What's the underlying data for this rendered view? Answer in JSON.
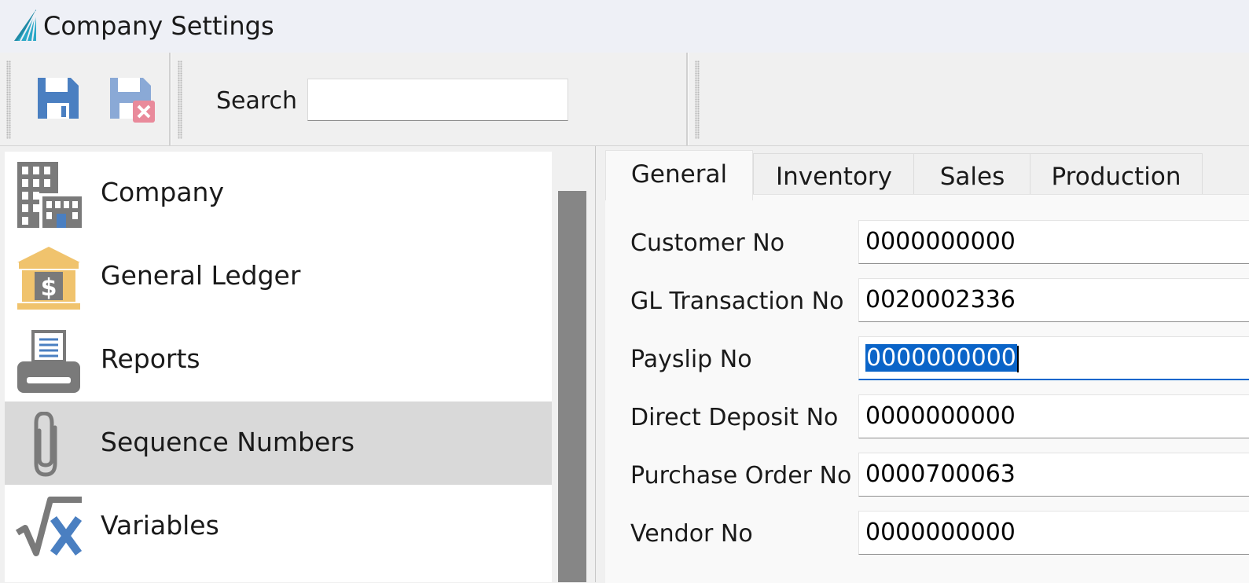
{
  "window": {
    "title": "Company Settings",
    "logo_icon": "app-logo-icon"
  },
  "toolbar": {
    "save_icon": "save-icon",
    "cancel_icon": "save-cancel-icon",
    "search_label": "Search",
    "search_value": ""
  },
  "nav": {
    "items": [
      {
        "label": "Company",
        "icon": "building-icon",
        "selected": false
      },
      {
        "label": "General Ledger",
        "icon": "bank-icon",
        "selected": false
      },
      {
        "label": "Reports",
        "icon": "printer-icon",
        "selected": false
      },
      {
        "label": "Sequence Numbers",
        "icon": "paperclip-icon",
        "selected": true
      },
      {
        "label": "Variables",
        "icon": "square-root-x-icon",
        "selected": false
      }
    ]
  },
  "tabs": [
    {
      "label": "General",
      "active": true
    },
    {
      "label": "Inventory",
      "active": false
    },
    {
      "label": "Sales",
      "active": false
    },
    {
      "label": "Production",
      "active": false
    }
  ],
  "fields": [
    {
      "label": "Customer No",
      "value": "0000000000"
    },
    {
      "label": "GL Transaction No",
      "value": "0020002336"
    },
    {
      "label": "Payslip No",
      "value": "0000000000",
      "focused": true,
      "selected": true
    },
    {
      "label": "Direct Deposit No",
      "value": "0000000000"
    },
    {
      "label": "Purchase Order No",
      "value": "0000700063"
    },
    {
      "label": "Vendor No",
      "value": "0000000000"
    }
  ],
  "colors": {
    "accent": "#0a64c8",
    "save_icon": "#4a7fc1",
    "selected_row": "#d9d9d9"
  }
}
